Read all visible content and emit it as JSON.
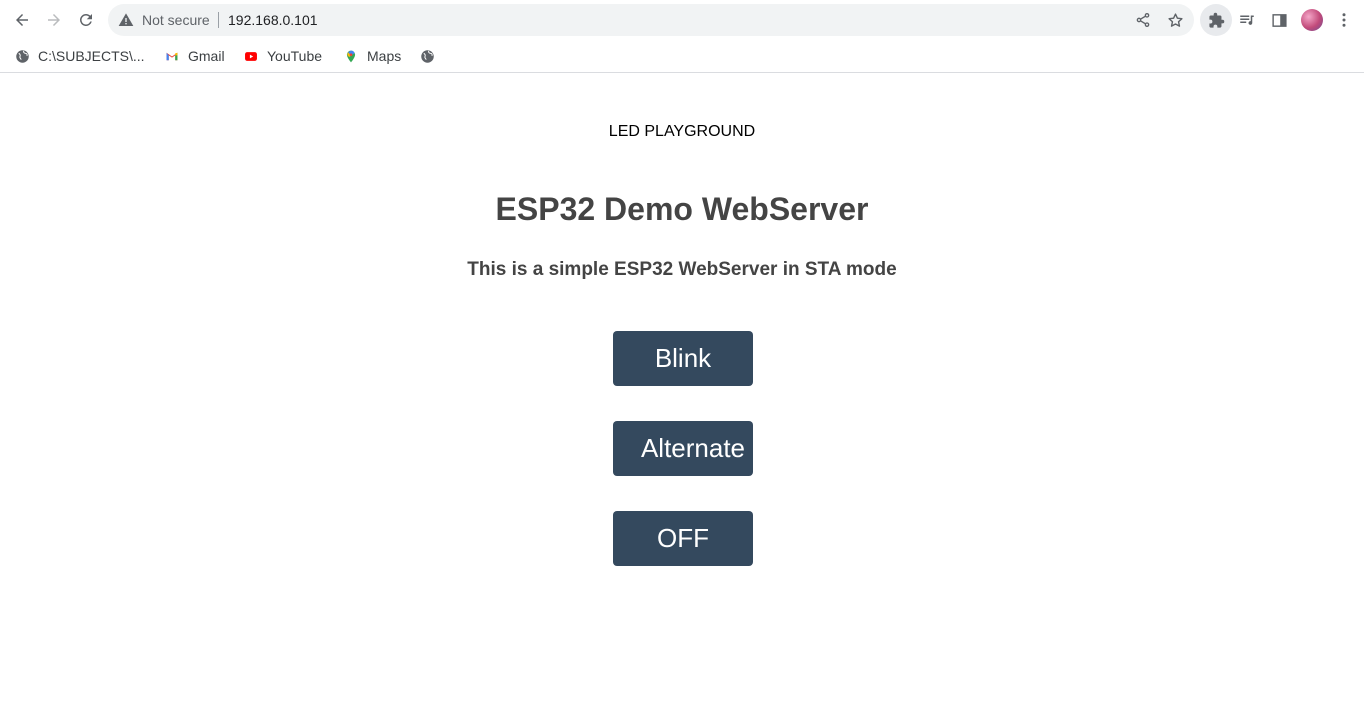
{
  "browser": {
    "security_label": "Not secure",
    "url": "192.168.0.101",
    "icons": {
      "back": "arrow-left-icon",
      "forward": "arrow-right-icon",
      "reload": "reload-icon",
      "warning": "warning-triangle-icon",
      "share": "share-icon",
      "bookmark": "star-icon",
      "extensions": "puzzle-icon",
      "media": "media-queue-icon",
      "side_panel": "side-panel-icon",
      "profile": "avatar",
      "menu": "kebab-menu-icon"
    }
  },
  "bookmarks": [
    {
      "label": "C:\\SUBJECTS\\...",
      "icon": "globe-icon"
    },
    {
      "label": "Gmail",
      "icon": "gmail-icon"
    },
    {
      "label": "YouTube",
      "icon": "youtube-icon"
    },
    {
      "label": "Maps",
      "icon": "maps-icon"
    },
    {
      "label": "",
      "icon": "globe-icon"
    }
  ],
  "page": {
    "label": "LED PLAYGROUND",
    "title": "ESP32 Demo WebServer",
    "subtitle": "This is a simple ESP32 WebServer in STA mode",
    "buttons": [
      "Blink",
      "Alternate",
      "OFF"
    ]
  },
  "colors": {
    "button_bg": "#34495e",
    "heading": "#444444"
  }
}
